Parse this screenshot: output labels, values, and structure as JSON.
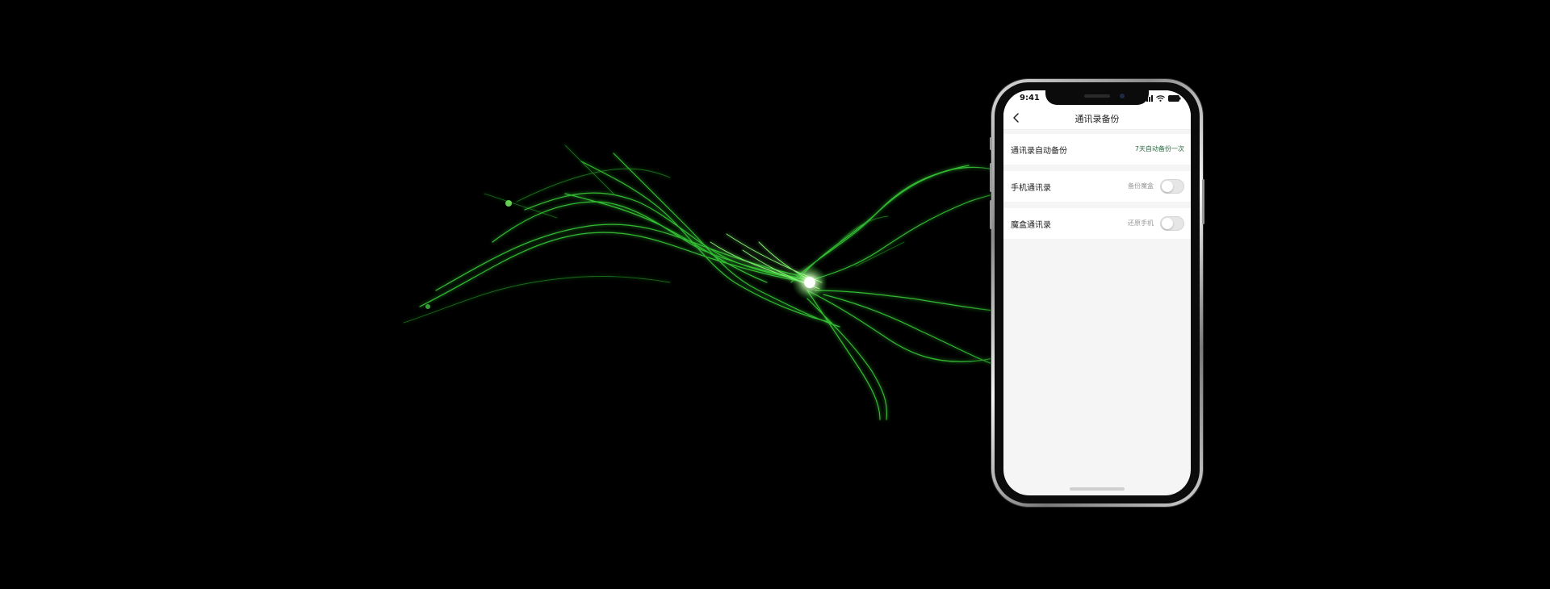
{
  "status_bar": {
    "time": "9:41",
    "icons": [
      "signal-icon",
      "wifi-icon",
      "battery-icon"
    ]
  },
  "nav": {
    "title": "通讯录备份",
    "back_icon": "chevron-left-icon"
  },
  "rows": [
    {
      "label": "通讯录自动备份",
      "value": "7天自动备份一次"
    },
    {
      "label": "手机通讯录",
      "hint": "备份魔盒",
      "toggle": "off"
    },
    {
      "label": "魔盒通讯录",
      "hint": "还原手机",
      "toggle": "off"
    }
  ],
  "colors": {
    "accent_green": "#2d6a43",
    "background": "#000000",
    "screen_background": "#f5f5f5"
  }
}
